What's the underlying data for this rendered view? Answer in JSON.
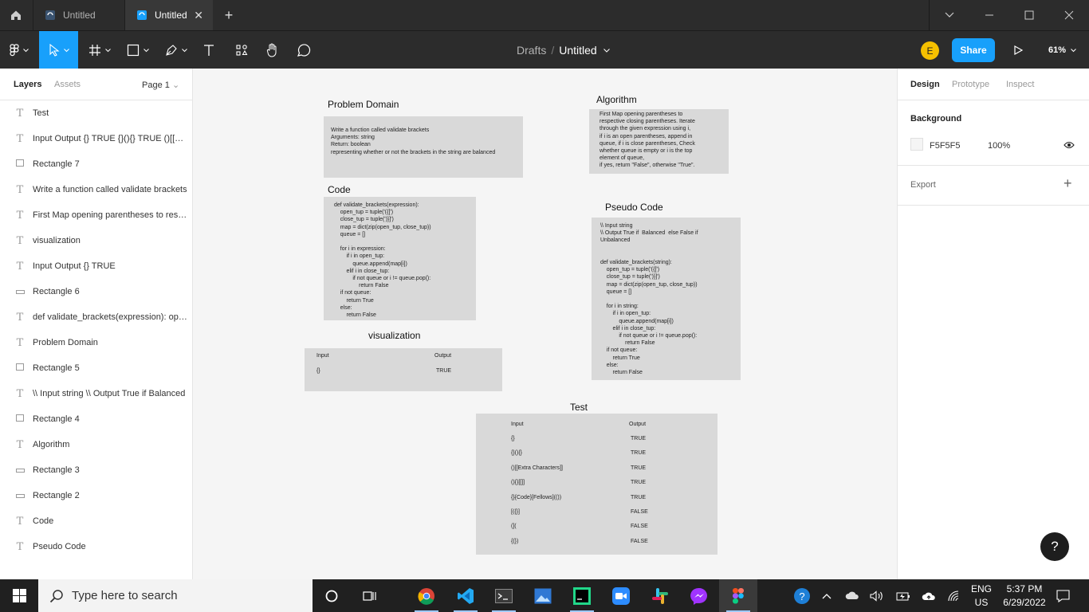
{
  "tabs": [
    {
      "label": "Untitled",
      "active": false
    },
    {
      "label": "Untitled",
      "active": true
    }
  ],
  "breadcrumb": {
    "project": "Drafts",
    "separator": "/",
    "file": "Untitled"
  },
  "user": {
    "initial": "E"
  },
  "share_label": "Share",
  "zoom": "61%",
  "left_panel": {
    "tab_layers": "Layers",
    "tab_assets": "Assets",
    "page": "Page 1",
    "layers": [
      {
        "icon": "text",
        "name": "Test"
      },
      {
        "icon": "text",
        "name": "Input Output {} TRUE {}(){} TRUE ()[[Extra Characters]] TRUE"
      },
      {
        "icon": "rect",
        "name": "Rectangle 7"
      },
      {
        "icon": "text",
        "name": "Write a function called validate brackets"
      },
      {
        "icon": "text",
        "name": "First Map opening parentheses to respective closing parentheses"
      },
      {
        "icon": "text",
        "name": "visualization"
      },
      {
        "icon": "text",
        "name": "Input Output {} TRUE"
      },
      {
        "icon": "line",
        "name": "Rectangle 6"
      },
      {
        "icon": "text",
        "name": "def validate_brackets(expression): open_tup"
      },
      {
        "icon": "text",
        "name": "Problem Domain"
      },
      {
        "icon": "rect",
        "name": "Rectangle 5"
      },
      {
        "icon": "text",
        "name": "\\\\ Input string \\\\ Output True if Balanced"
      },
      {
        "icon": "rect",
        "name": "Rectangle 4"
      },
      {
        "icon": "text",
        "name": "Algorithm"
      },
      {
        "icon": "line",
        "name": "Rectangle 3"
      },
      {
        "icon": "line",
        "name": "Rectangle 2"
      },
      {
        "icon": "text",
        "name": "Code"
      },
      {
        "icon": "text",
        "name": "Pseudo Code"
      }
    ]
  },
  "canvas": {
    "problem_domain": {
      "title": "Problem Domain",
      "body": "Write a function called validate brackets\nArguments: string\nReturn: boolean\nrepresenting whether or not the brackets in the string are balanced"
    },
    "algorithm": {
      "title": "Algorithm",
      "body": "First Map opening parentheses to\nrespective closing parentheses. Iterate\nthrough the given expression using i,\nif i is an open parentheses, append in\nqueue, if i is close parentheses, Check\nwhether queue is empty or i is the top\nelement of queue,\nif yes, return \"False\", otherwise \"True\"."
    },
    "code": {
      "title": "Code",
      "body": "def validate_brackets(expression):\n    open_tup = tuple('({[')\n    close_tup = tuple(')}]')\n    map = dict(zip(open_tup, close_tup))\n    queue = []\n\n    for i in expression:\n        if i in open_tup:\n            queue.append(map[i])\n        elif i in close_tup:\n            if not queue or i != queue.pop():\n                return False\n    if not queue:\n        return True\n    else:\n        return False"
    },
    "pseudo_code": {
      "title": "Pseudo Code",
      "body": "\\\\ Input string\n\\\\ Output True if  Balanced  else False if\nUnbalanced\n\n\ndef validate_brackets(string):\n    open_tup = tuple('({[')\n    close_tup = tuple(')}]')\n    map = dict(zip(open_tup, close_tup))\n    queue = []\n\n    for i in string:\n        if i in open_tup:\n            queue.append(map[i])\n        elif i in close_tup:\n            if not queue or i != queue.pop():\n                return False\n    if not queue:\n        return True\n    else:\n        return False"
    },
    "visualization": {
      "title": "visualization",
      "col_input": "Input",
      "col_output": "Output",
      "rows": [
        {
          "input": "{}",
          "output": "TRUE"
        }
      ]
    },
    "test": {
      "title": "Test",
      "col_input": "Input",
      "col_output": "Output",
      "rows": [
        {
          "input": "{}",
          "output": "TRUE"
        },
        {
          "input": "{}(){}",
          "output": "TRUE"
        },
        {
          "input": "()[[Extra Characters]]",
          "output": "TRUE"
        },
        {
          "input": "(){}[[]]",
          "output": "TRUE"
        },
        {
          "input": "{}{Code}[Fellows](())",
          "output": "TRUE"
        },
        {
          "input": "[({}]",
          "output": "FALSE"
        },
        {
          "input": "(](",
          "output": "FALSE"
        },
        {
          "input": "{(})",
          "output": "FALSE"
        }
      ]
    }
  },
  "right_panel": {
    "tab_design": "Design",
    "tab_prototype": "Prototype",
    "tab_inspect": "Inspect",
    "background_label": "Background",
    "background_hex": "F5F5F5",
    "background_opacity": "100%",
    "export_label": "Export",
    "export_add": "+"
  },
  "help_label": "?",
  "taskbar": {
    "search_placeholder": "Type here to search",
    "lang_top": "ENG",
    "lang_bottom": "US",
    "time": "5:37 PM",
    "date": "6/29/2022"
  },
  "colors": {
    "accent": "#18a0fb",
    "chrome": "#2c2c2c",
    "canvas": "#f5f5f5",
    "card": "#d9d9d9",
    "avatar": "#f5c000"
  }
}
